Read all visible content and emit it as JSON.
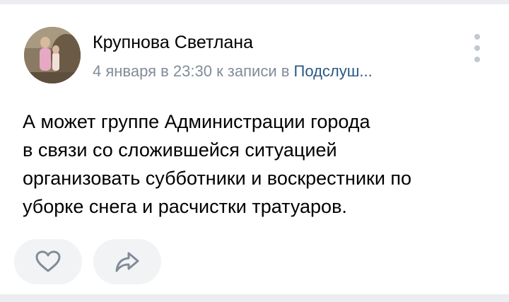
{
  "post": {
    "author": "Крупнова Светлана",
    "meta_prefix": "4 января в 23:30 к записи в ",
    "meta_link": "Подслуш...",
    "text_lines": [
      "А может группе Администрации города",
      "в связи со сложившейся ситуацией",
      "организовать субботники и воскрестники по",
      "уборке снега и расчистки тратуаров."
    ]
  },
  "icons": {
    "avatar": "user-photo",
    "more": "more-vertical-icon",
    "like": "heart-icon",
    "share": "share-arrow-icon"
  },
  "colors": {
    "meta": "#818c99",
    "link": "#2a5885",
    "button_bg": "#f2f3f5",
    "icon": "#818c99"
  }
}
